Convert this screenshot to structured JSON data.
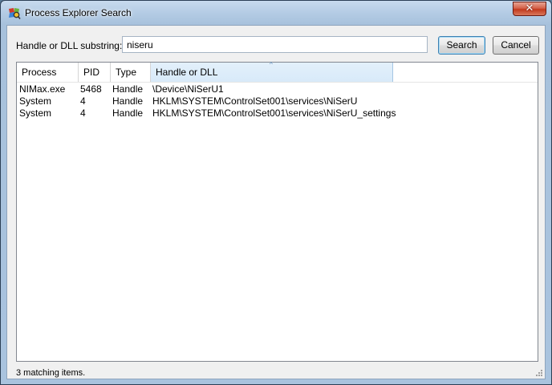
{
  "window": {
    "title": "Process Explorer Search",
    "close_glyph": "✕"
  },
  "search": {
    "label": "Handle or DLL substring:",
    "value": "niseru",
    "search_label": "Search",
    "cancel_label": "Cancel"
  },
  "columns": [
    "Process",
    "PID",
    "Type",
    "Handle or DLL"
  ],
  "sort": {
    "column": "Handle or DLL",
    "direction": "ascending",
    "indicator": "^"
  },
  "rows": [
    {
      "process": "NIMax.exe",
      "pid": "5468",
      "type": "Handle",
      "handle": "\\Device\\NiSerU1"
    },
    {
      "process": "System",
      "pid": "4",
      "type": "Handle",
      "handle": "HKLM\\SYSTEM\\ControlSet001\\services\\NiSerU"
    },
    {
      "process": "System",
      "pid": "4",
      "type": "Handle",
      "handle": "HKLM\\SYSTEM\\ControlSet001\\services\\NiSerU_settings"
    }
  ],
  "status": "3 matching items.",
  "colors": {
    "selected_column_header": "#dbecfa",
    "search_button_border": "#3c7fb1",
    "close_button": "#c8452b"
  },
  "icons": [
    "process-explorer-app-icon",
    "close-icon",
    "sort-ascending-icon",
    "resize-grip-icon"
  ]
}
